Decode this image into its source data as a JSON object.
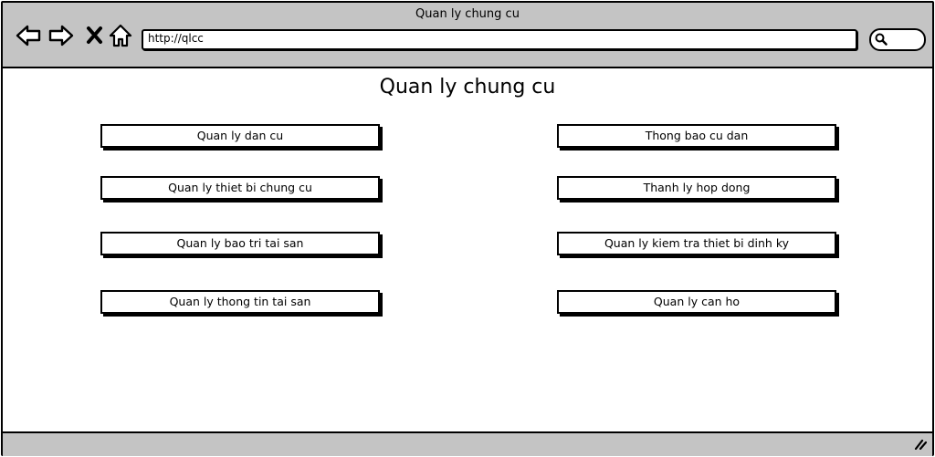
{
  "window": {
    "title": "Quan ly chung cu",
    "url": "http://qlcc"
  },
  "page": {
    "heading": "Quan ly chung cu",
    "left_buttons": [
      "Quan ly dan cu",
      "Quan ly thiet bi chung cu",
      "Quan ly bao tri tai san",
      "Quan ly thong tin tai san"
    ],
    "right_buttons": [
      "Thong bao cu dan",
      "Thanh ly hop dong",
      "Quan ly kiem tra thiet bi dinh ky",
      "Quan ly can ho"
    ]
  },
  "icons": {
    "back": "back-arrow-icon",
    "forward": "forward-arrow-icon",
    "stop": "close-icon",
    "home": "home-icon",
    "search": "search-icon",
    "resize": "resize-grip-icon"
  }
}
